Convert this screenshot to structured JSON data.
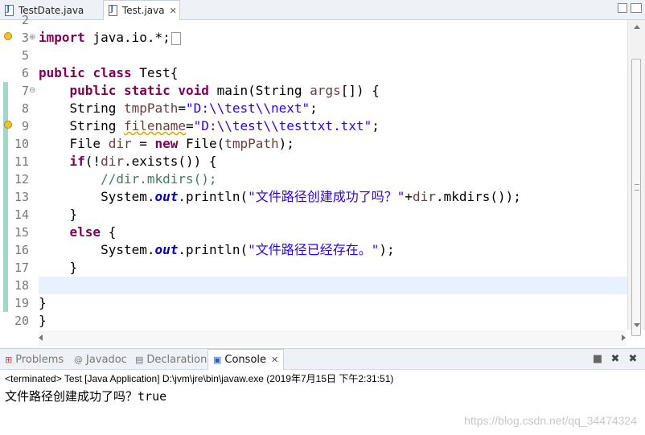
{
  "editor_tabs": [
    {
      "label": "TestDate.java",
      "active": false
    },
    {
      "label": "Test.java",
      "active": true,
      "close": "✕"
    }
  ],
  "code_lines": [
    {
      "n": "2",
      "text": ""
    },
    {
      "n": "3",
      "text": "import java.io.*;"
    },
    {
      "n": "5",
      "text": ""
    },
    {
      "n": "6",
      "text": "public class Test{"
    },
    {
      "n": "7",
      "text": "    public static void main(String args[]) {"
    },
    {
      "n": "8",
      "text": "    String tmpPath=\"D:\\\\test\\\\next\";"
    },
    {
      "n": "9",
      "text": "    String filename=\"D:\\\\test\\\\testtxt.txt\";"
    },
    {
      "n": "10",
      "text": "    File dir = new File(tmpPath);"
    },
    {
      "n": "11",
      "text": "    if(!dir.exists()) {"
    },
    {
      "n": "12",
      "text": "        //dir.mkdirs();"
    },
    {
      "n": "13",
      "text": "        System.out.println(\"文件路径创建成功了吗？\"+dir.mkdirs());"
    },
    {
      "n": "14",
      "text": "    }"
    },
    {
      "n": "15",
      "text": "    else {"
    },
    {
      "n": "16",
      "text": "        System.out.println(\"文件路径已经存在。\");"
    },
    {
      "n": "17",
      "text": "    }"
    },
    {
      "n": "18",
      "text": ""
    },
    {
      "n": "19",
      "text": "}"
    },
    {
      "n": "20",
      "text": "}"
    }
  ],
  "console": {
    "tabs": [
      {
        "label": "Problems",
        "icon": "problems-icon"
      },
      {
        "label": "Javadoc",
        "icon": "at-icon"
      },
      {
        "label": "Declaration",
        "icon": "declaration-icon"
      },
      {
        "label": "Console",
        "icon": "console-icon",
        "active": true,
        "close": "✕"
      }
    ],
    "status": "<terminated> Test [Java Application] D:\\jvm\\jre\\bin\\javaw.exe (2019年7月15日 下午2:31:51)",
    "output": "文件路径创建成功了吗？true"
  },
  "watermark": "https://blog.csdn.net/qq_34474324",
  "colors": {
    "keyword": "#7f0055",
    "string": "#2a00ff",
    "comment": "#3f7f5f",
    "field": "#0000c0"
  }
}
